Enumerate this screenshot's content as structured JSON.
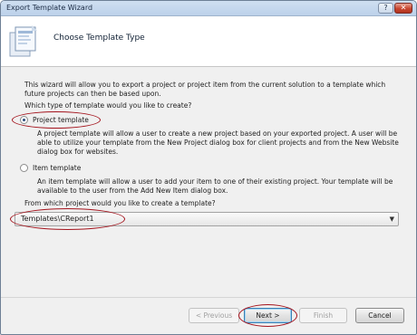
{
  "window": {
    "title": "Export Template Wizard",
    "help_label": "?",
    "close_label": "✕"
  },
  "header": {
    "title": "Choose Template Type",
    "icon": "wizard-page-icon"
  },
  "content": {
    "intro_line1": "This wizard will allow you to export a project or project item from the current solution to a template which",
    "intro_line2": "future projects can then be based upon.",
    "question": "Which type of template would you like to create?",
    "project_option": {
      "label": "Project template",
      "checked": true,
      "desc_line1": "A project template will allow a user to create a new project based on your exported project. A user will be",
      "desc_line2": "able to utilize your template from the New Project dialog box for client projects and from the New Website",
      "desc_line3": "dialog box for websites."
    },
    "item_option": {
      "label": "Item template",
      "checked": false,
      "desc_line1": "An item template will allow a user to add your item to one of their existing project. Your template will be",
      "desc_line2": "available to the user from the Add New Item dialog box."
    },
    "project_question": "From which project would you like to create a template?",
    "project_select": {
      "value": "Templates\\CReport1",
      "arrow": "▼"
    }
  },
  "buttons": {
    "previous": "< Previous",
    "next": "Next >",
    "finish": "Finish",
    "cancel": "Cancel"
  },
  "colors": {
    "annotation": "#a4141d",
    "titlebar": "#bcd1ea"
  }
}
